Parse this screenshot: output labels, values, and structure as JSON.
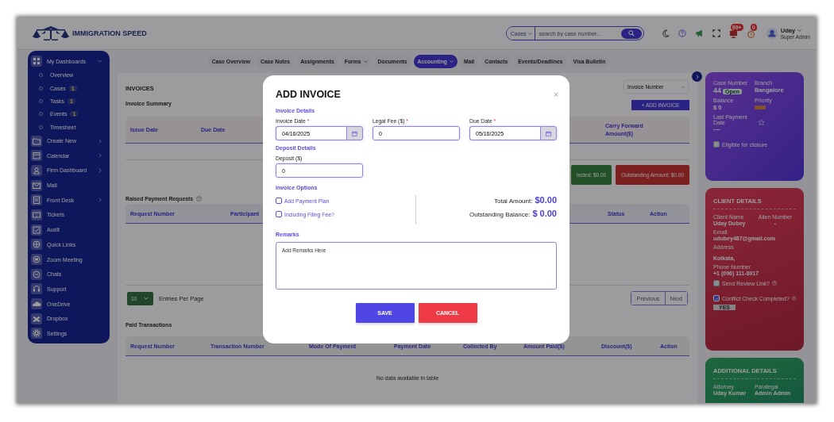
{
  "header": {
    "logo_text": "IMMIGRATION SPEED",
    "search_scope": "Cases",
    "search_placeholder": "search by case number...",
    "notifications_count": "99+",
    "reminders_count": "0",
    "user": {
      "name": "Uday",
      "role": "Super Admin"
    }
  },
  "sidebar": {
    "items": [
      {
        "label": "My Dashboards",
        "expanded": true,
        "children": [
          {
            "label": "Overview"
          },
          {
            "label": "Cases",
            "badge": "1"
          },
          {
            "label": "Tasks",
            "badge": "1"
          },
          {
            "label": "Events",
            "badge": "1"
          },
          {
            "label": "Timesheet"
          }
        ]
      },
      {
        "label": "Create New",
        "expanded": false
      },
      {
        "label": "Calendar",
        "expanded": false
      },
      {
        "label": "Firm Dashboard",
        "expanded": false
      },
      {
        "label": "Mail"
      },
      {
        "label": "Front Desk",
        "expanded": false
      },
      {
        "label": "Tickets"
      },
      {
        "label": "Audit"
      },
      {
        "label": "Quick Links"
      },
      {
        "label": "Zoom Meeting"
      },
      {
        "label": "Chats"
      },
      {
        "label": "Support"
      },
      {
        "label": "OneDrive"
      },
      {
        "label": "Dropbox"
      },
      {
        "label": "Settings"
      }
    ]
  },
  "tabs": [
    {
      "label": "Case Overview",
      "selected": false,
      "dropdown": false
    },
    {
      "label": "Case Notes",
      "selected": false,
      "dropdown": false
    },
    {
      "label": "Assignments",
      "selected": false,
      "dropdown": false
    },
    {
      "label": "Forms",
      "selected": false,
      "dropdown": true
    },
    {
      "label": "Documents",
      "selected": false,
      "dropdown": false
    },
    {
      "label": "Accounting",
      "selected": true,
      "dropdown": true
    },
    {
      "label": "Mail",
      "selected": false,
      "dropdown": false
    },
    {
      "label": "Contacts",
      "selected": false,
      "dropdown": false
    },
    {
      "label": "Events/Deadlines",
      "selected": false,
      "dropdown": false
    },
    {
      "label": "Visa Bulletin",
      "selected": false,
      "dropdown": false
    }
  ],
  "invoices": {
    "title": "INVOICES",
    "subtitle": "Invoice Summary",
    "sort_select": "Invoice Number",
    "add_button": "+ ADD INVOICE",
    "summary_columns": [
      "Issue Date",
      "Due Date",
      "Carry Forward Amount($)"
    ],
    "totals": [
      {
        "label": "lected: $0.00",
        "kind": "collected"
      },
      {
        "label": "Outstanding Amount: $0.00",
        "kind": "outstanding"
      }
    ],
    "raised": {
      "title": "Raised Payment Requests",
      "columns": [
        "Request Number",
        "Participant",
        "Status",
        "Action"
      ],
      "entries": "10",
      "entries_label": "Entries Per Page",
      "pagination": [
        "Previous",
        "Next"
      ]
    },
    "paid": {
      "title": "Paid Transactions",
      "columns": [
        "Request Number",
        "Transaction Number",
        "Mode Of Payment",
        "Payment Date",
        "Collected By",
        "Amount Paid($)",
        "Discount($)",
        "Action"
      ],
      "empty": "No data available in table"
    }
  },
  "case_card": {
    "case_number_label": "Case Number",
    "case_number": "44",
    "status": "Open",
    "branch_label": "Branch",
    "branch": "Bangalore",
    "balance_label": "Balance",
    "balance": "$ 0",
    "priority_label": "Priority",
    "last_payment_label": "Last Payment Date",
    "last_payment": "----",
    "starred": false,
    "closure": {
      "label": "Eligible for closure",
      "checked": false
    }
  },
  "client_card": {
    "title": "CLIENT DETAILS",
    "fields": [
      {
        "label": "Client Name",
        "value": "Uday Dubey"
      },
      {
        "label": "Alien Number",
        "value": "-"
      },
      {
        "label": "Email",
        "value": "udubey487@gmail.com"
      },
      {
        "label": "Address",
        "value": "Kolkata,"
      },
      {
        "label": "Phone Number",
        "value": "+1 (096) 111-8917"
      }
    ],
    "checks": [
      {
        "label": "Send Review Link?",
        "checked": false
      },
      {
        "label": "Conflict Check Completed?",
        "checked": true
      }
    ],
    "conflict_result": "YES"
  },
  "additional_card": {
    "title": "ADDITIONAL DETAILS",
    "fields": [
      {
        "label": "Attorney",
        "value": "Uday Kumar"
      },
      {
        "label": "Paralegal",
        "value": "Admin Admin"
      }
    ]
  },
  "modal": {
    "title": "ADD INVOICE",
    "close": "×",
    "invoice_details": {
      "heading": "Invoice Details",
      "fields": [
        {
          "label": "Invoice Date",
          "mark": "*",
          "value": "04/16/2025",
          "kind": "date"
        },
        {
          "label": "Legal Fee ($)",
          "mark": "*",
          "value": "0",
          "kind": "text"
        },
        {
          "label": "Due Date",
          "mark": "*",
          "value": "05/16/2025",
          "kind": "date"
        }
      ]
    },
    "deposit_details": {
      "heading": "Deposit Details",
      "fields": [
        {
          "label": "Deposit ($)",
          "value": "0",
          "kind": "text"
        }
      ]
    },
    "invoice_options": {
      "heading": "Invoice Options",
      "options": [
        {
          "label": "Add Payment Plan",
          "checked": false
        },
        {
          "label": "Including Filing Fee?",
          "checked": false
        }
      ],
      "totals": [
        {
          "label": "Total Amount:",
          "value": "$0.00"
        },
        {
          "label": "Outstanding Balance:",
          "value": "$ 0.00"
        }
      ]
    },
    "remarks": {
      "heading": "Remarks",
      "placeholder": "Add Remarks Here"
    },
    "buttons": [
      {
        "label": "SAVE",
        "kind": "primary"
      },
      {
        "label": "CANCEL",
        "kind": "danger"
      }
    ]
  }
}
